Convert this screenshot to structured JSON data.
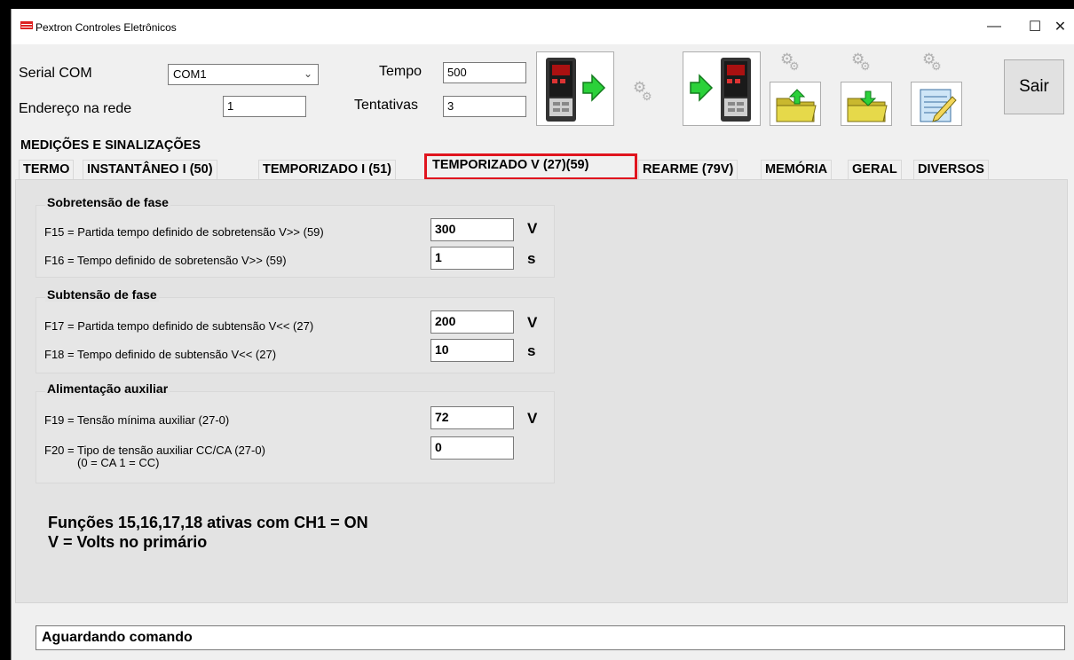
{
  "window": {
    "title": "Pextron Controles Eletrônicos",
    "min_glyph": "—",
    "max_glyph": "☐",
    "close_glyph": "✕"
  },
  "top": {
    "serial_label": "Serial COM",
    "serial_value": "COM1",
    "address_label": "Endereço na rede",
    "address_value": "1",
    "tempo_label": "Tempo",
    "tempo_value": "500",
    "tentativas_label": "Tentativas",
    "tentativas_value": "3",
    "sair_label": "Sair"
  },
  "icons": {
    "read_device": "device-read-icon",
    "write_device": "device-write-icon",
    "open_folder": "folder-upload-icon",
    "save_folder": "folder-download-icon",
    "edit": "edit-notepad-icon",
    "gear": "gears-icon"
  },
  "tabs": {
    "row1": [
      "MEDIÇÕES E SINALIZAÇÕES"
    ],
    "row2": [
      "TERMO",
      "INSTANTÂNEO I (50)",
      "TEMPORIZADO I (51)",
      "TEMPORIZADO V (27)(59)",
      "REARME (79V)",
      "MEMÓRIA",
      "GERAL",
      "DIVERSOS"
    ],
    "active": "TEMPORIZADO V (27)(59)"
  },
  "groups": [
    {
      "title": "Sobretensão de fase",
      "fields": [
        {
          "label": "F15 = Partida tempo definido de sobretensão V>> (59)",
          "value": "300",
          "unit": "V"
        },
        {
          "label": "F16 = Tempo definido de sobretensão V>> (59)",
          "value": "1",
          "unit": "s"
        }
      ]
    },
    {
      "title": "Subtensão de fase",
      "fields": [
        {
          "label": "F17 = Partida tempo definido de subtensão V<< (27)",
          "value": "200",
          "unit": "V"
        },
        {
          "label": "F18 = Tempo definido de subtensão V<< (27)",
          "value": "10",
          "unit": "s"
        }
      ]
    },
    {
      "title": "Alimentação auxiliar",
      "fields": [
        {
          "label": "F19 = Tensão mínima auxiliar (27-0)",
          "value": "72",
          "unit": "V"
        },
        {
          "label": "F20 = Tipo de tensão auxiliar CC/CA (27-0)",
          "label2": "(0 = CA   1 = CC)",
          "value": "0",
          "unit": ""
        }
      ]
    }
  ],
  "notes": {
    "line1": "Funções 15,16,17,18 ativas com CH1 = ON",
    "line2": "V = Volts no primário"
  },
  "status": "Aguardando comando",
  "colors": {
    "active_tab_highlight": "#e0141e",
    "arrow_green": "#2bd13a",
    "folder_yellow": "#d9c83a"
  }
}
